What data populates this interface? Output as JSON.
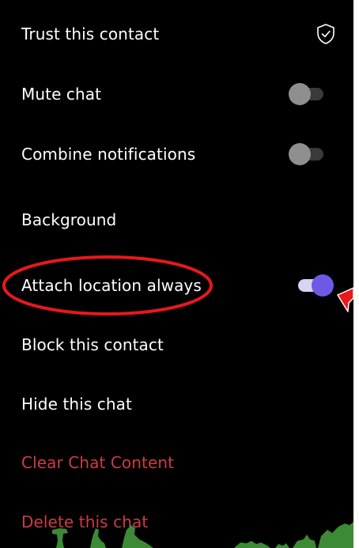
{
  "settings": {
    "items": [
      {
        "label": "Trust this contact",
        "control": "shield-icon"
      },
      {
        "label": "Mute chat",
        "control": "toggle",
        "enabled": false
      },
      {
        "label": "Combine notifications",
        "control": "toggle",
        "enabled": false
      },
      {
        "label": "Background",
        "control": "none"
      },
      {
        "label": "Attach location always",
        "control": "toggle",
        "enabled": true
      },
      {
        "label": "Block this contact",
        "control": "none"
      },
      {
        "label": "Hide this chat",
        "control": "none"
      },
      {
        "label": "Clear Chat Content",
        "control": "none",
        "style": "danger"
      },
      {
        "label": "Delete this chat",
        "control": "none",
        "style": "danger"
      }
    ]
  },
  "colors": {
    "background": "#000000",
    "text": "#ffffff",
    "danger": "#cf3b44",
    "toggle_on_thumb": "#6c5ae6",
    "toggle_on_track": "#d7d5f4",
    "toggle_off_thumb": "#8f8f8f",
    "toggle_off_track": "#3a3a3a",
    "annotation": "#e8181b",
    "foliage": "#3c8a36"
  }
}
